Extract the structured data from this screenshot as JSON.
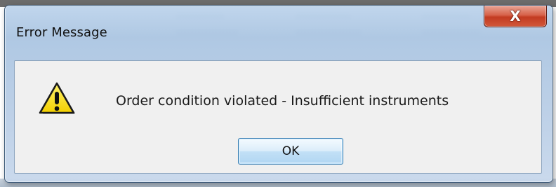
{
  "dialog": {
    "title": "Error Message",
    "close_glyph": "X",
    "message": "Order condition violated - Insufficient instruments",
    "icon": "warning-icon",
    "ok_label": "OK"
  },
  "colors": {
    "titlebar": "#b4cae3",
    "close_button": "#c94a30",
    "client_area": "#f0f0f0",
    "ok_border": "#3c7fb1",
    "warning_yellow": "#ffe21f"
  }
}
